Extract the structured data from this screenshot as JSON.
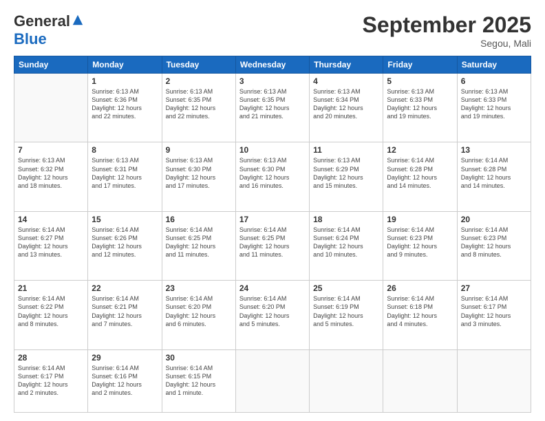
{
  "header": {
    "logo_general": "General",
    "logo_blue": "Blue",
    "month_title": "September 2025",
    "location": "Segou, Mali"
  },
  "days_of_week": [
    "Sunday",
    "Monday",
    "Tuesday",
    "Wednesday",
    "Thursday",
    "Friday",
    "Saturday"
  ],
  "weeks": [
    [
      {
        "day": "",
        "info": ""
      },
      {
        "day": "1",
        "info": "Sunrise: 6:13 AM\nSunset: 6:36 PM\nDaylight: 12 hours\nand 22 minutes."
      },
      {
        "day": "2",
        "info": "Sunrise: 6:13 AM\nSunset: 6:35 PM\nDaylight: 12 hours\nand 22 minutes."
      },
      {
        "day": "3",
        "info": "Sunrise: 6:13 AM\nSunset: 6:35 PM\nDaylight: 12 hours\nand 21 minutes."
      },
      {
        "day": "4",
        "info": "Sunrise: 6:13 AM\nSunset: 6:34 PM\nDaylight: 12 hours\nand 20 minutes."
      },
      {
        "day": "5",
        "info": "Sunrise: 6:13 AM\nSunset: 6:33 PM\nDaylight: 12 hours\nand 19 minutes."
      },
      {
        "day": "6",
        "info": "Sunrise: 6:13 AM\nSunset: 6:33 PM\nDaylight: 12 hours\nand 19 minutes."
      }
    ],
    [
      {
        "day": "7",
        "info": "Sunrise: 6:13 AM\nSunset: 6:32 PM\nDaylight: 12 hours\nand 18 minutes."
      },
      {
        "day": "8",
        "info": "Sunrise: 6:13 AM\nSunset: 6:31 PM\nDaylight: 12 hours\nand 17 minutes."
      },
      {
        "day": "9",
        "info": "Sunrise: 6:13 AM\nSunset: 6:30 PM\nDaylight: 12 hours\nand 17 minutes."
      },
      {
        "day": "10",
        "info": "Sunrise: 6:13 AM\nSunset: 6:30 PM\nDaylight: 12 hours\nand 16 minutes."
      },
      {
        "day": "11",
        "info": "Sunrise: 6:13 AM\nSunset: 6:29 PM\nDaylight: 12 hours\nand 15 minutes."
      },
      {
        "day": "12",
        "info": "Sunrise: 6:14 AM\nSunset: 6:28 PM\nDaylight: 12 hours\nand 14 minutes."
      },
      {
        "day": "13",
        "info": "Sunrise: 6:14 AM\nSunset: 6:28 PM\nDaylight: 12 hours\nand 14 minutes."
      }
    ],
    [
      {
        "day": "14",
        "info": "Sunrise: 6:14 AM\nSunset: 6:27 PM\nDaylight: 12 hours\nand 13 minutes."
      },
      {
        "day": "15",
        "info": "Sunrise: 6:14 AM\nSunset: 6:26 PM\nDaylight: 12 hours\nand 12 minutes."
      },
      {
        "day": "16",
        "info": "Sunrise: 6:14 AM\nSunset: 6:25 PM\nDaylight: 12 hours\nand 11 minutes."
      },
      {
        "day": "17",
        "info": "Sunrise: 6:14 AM\nSunset: 6:25 PM\nDaylight: 12 hours\nand 11 minutes."
      },
      {
        "day": "18",
        "info": "Sunrise: 6:14 AM\nSunset: 6:24 PM\nDaylight: 12 hours\nand 10 minutes."
      },
      {
        "day": "19",
        "info": "Sunrise: 6:14 AM\nSunset: 6:23 PM\nDaylight: 12 hours\nand 9 minutes."
      },
      {
        "day": "20",
        "info": "Sunrise: 6:14 AM\nSunset: 6:23 PM\nDaylight: 12 hours\nand 8 minutes."
      }
    ],
    [
      {
        "day": "21",
        "info": "Sunrise: 6:14 AM\nSunset: 6:22 PM\nDaylight: 12 hours\nand 8 minutes."
      },
      {
        "day": "22",
        "info": "Sunrise: 6:14 AM\nSunset: 6:21 PM\nDaylight: 12 hours\nand 7 minutes."
      },
      {
        "day": "23",
        "info": "Sunrise: 6:14 AM\nSunset: 6:20 PM\nDaylight: 12 hours\nand 6 minutes."
      },
      {
        "day": "24",
        "info": "Sunrise: 6:14 AM\nSunset: 6:20 PM\nDaylight: 12 hours\nand 5 minutes."
      },
      {
        "day": "25",
        "info": "Sunrise: 6:14 AM\nSunset: 6:19 PM\nDaylight: 12 hours\nand 5 minutes."
      },
      {
        "day": "26",
        "info": "Sunrise: 6:14 AM\nSunset: 6:18 PM\nDaylight: 12 hours\nand 4 minutes."
      },
      {
        "day": "27",
        "info": "Sunrise: 6:14 AM\nSunset: 6:17 PM\nDaylight: 12 hours\nand 3 minutes."
      }
    ],
    [
      {
        "day": "28",
        "info": "Sunrise: 6:14 AM\nSunset: 6:17 PM\nDaylight: 12 hours\nand 2 minutes."
      },
      {
        "day": "29",
        "info": "Sunrise: 6:14 AM\nSunset: 6:16 PM\nDaylight: 12 hours\nand 2 minutes."
      },
      {
        "day": "30",
        "info": "Sunrise: 6:14 AM\nSunset: 6:15 PM\nDaylight: 12 hours\nand 1 minute."
      },
      {
        "day": "",
        "info": ""
      },
      {
        "day": "",
        "info": ""
      },
      {
        "day": "",
        "info": ""
      },
      {
        "day": "",
        "info": ""
      }
    ]
  ]
}
